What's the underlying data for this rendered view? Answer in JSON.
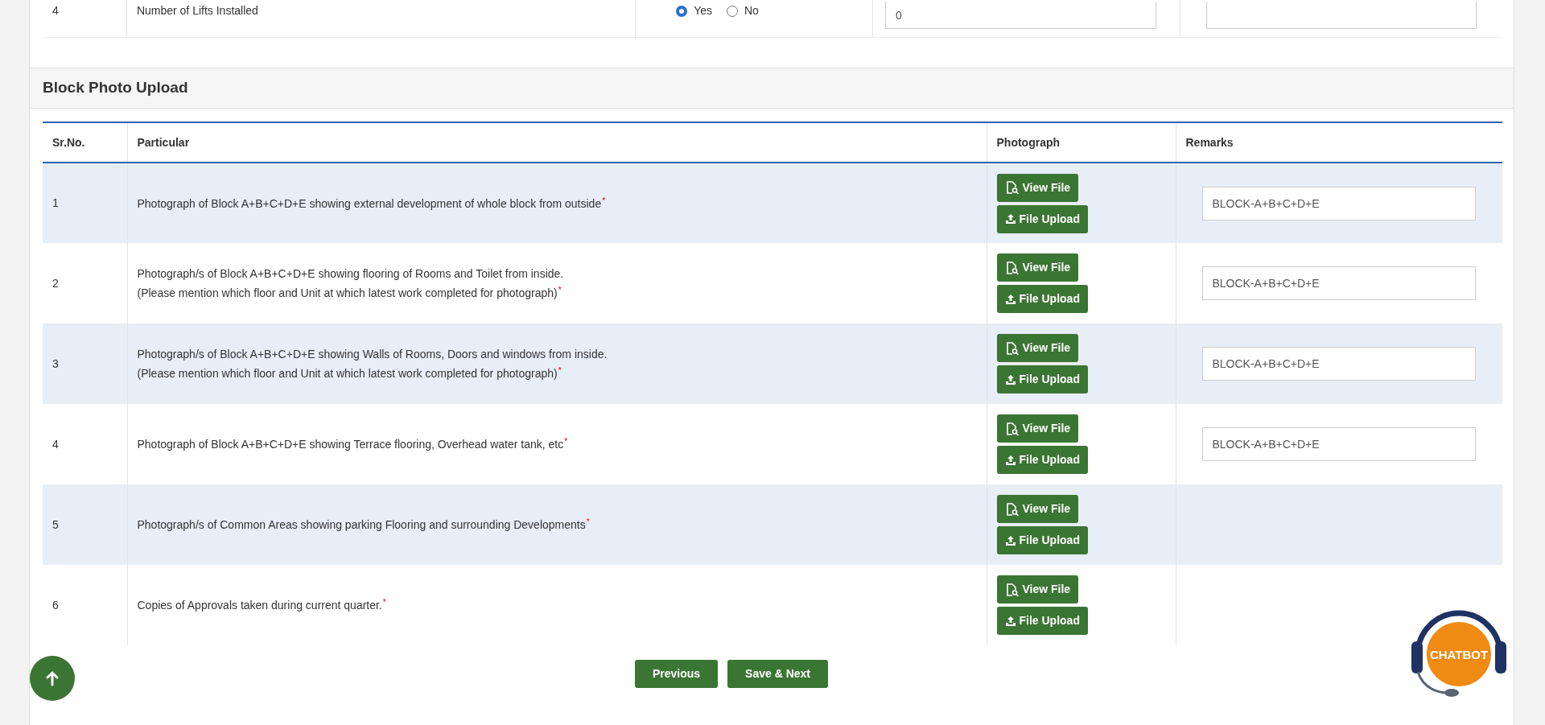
{
  "top_row": {
    "sr": "4",
    "particular": "Number of Lifts Installed",
    "options": [
      {
        "label": "Yes",
        "selected": true
      },
      {
        "label": "No",
        "selected": false
      }
    ],
    "value": "0"
  },
  "section": {
    "title": "Block Photo Upload"
  },
  "table": {
    "columns": [
      "Sr.No.",
      "Particular",
      "Photograph",
      "Remarks"
    ],
    "rows": [
      {
        "sr": "1",
        "lines": [
          "Photograph of Block A+B+C+D+E showing external development of whole block from outside$^{*}$"
        ],
        "view": "View File",
        "upload": "File Upload",
        "remarks": "BLOCK-A+B+C+D+E"
      },
      {
        "sr": "2",
        "lines": [
          "Photograph/s of Block A+B+C+D+E showing flooring of Rooms and Toilet from inside.",
          "(Please mention which floor and Unit at which latest work completed for photograph)$^{*}$"
        ],
        "view": "View File",
        "upload": "File Upload",
        "remarks": "BLOCK-A+B+C+D+E"
      },
      {
        "sr": "3",
        "lines": [
          "Photograph/s of Block A+B+C+D+E showing Walls of Rooms, Doors and windows from inside.",
          "(Please mention which floor and Unit at which latest work completed for photograph)$^{*}$"
        ],
        "view": "View File",
        "upload": "File Upload",
        "remarks": "BLOCK-A+B+C+D+E"
      },
      {
        "sr": "4",
        "lines": [
          "Photograph of Block A+B+C+D+E showing Terrace flooring, Overhead water tank, etc$^{*}$"
        ],
        "view": "View File",
        "upload": "File Upload",
        "remarks": "BLOCK-A+B+C+D+E"
      },
      {
        "sr": "5",
        "lines": [
          "Photograph/s of Common Areas showing parking Flooring and surrounding Developments$^{*}$"
        ],
        "view": "View File",
        "upload": "File Upload"
      },
      {
        "sr": "6",
        "lines": [
          "Copies of Approvals taken during current quarter.$^{*}$"
        ],
        "view": "View File",
        "upload": "File Upload"
      }
    ]
  },
  "buttons": [
    "Previous",
    "Save & Next"
  ],
  "chatbot": {
    "label": "CHATBOT"
  }
}
